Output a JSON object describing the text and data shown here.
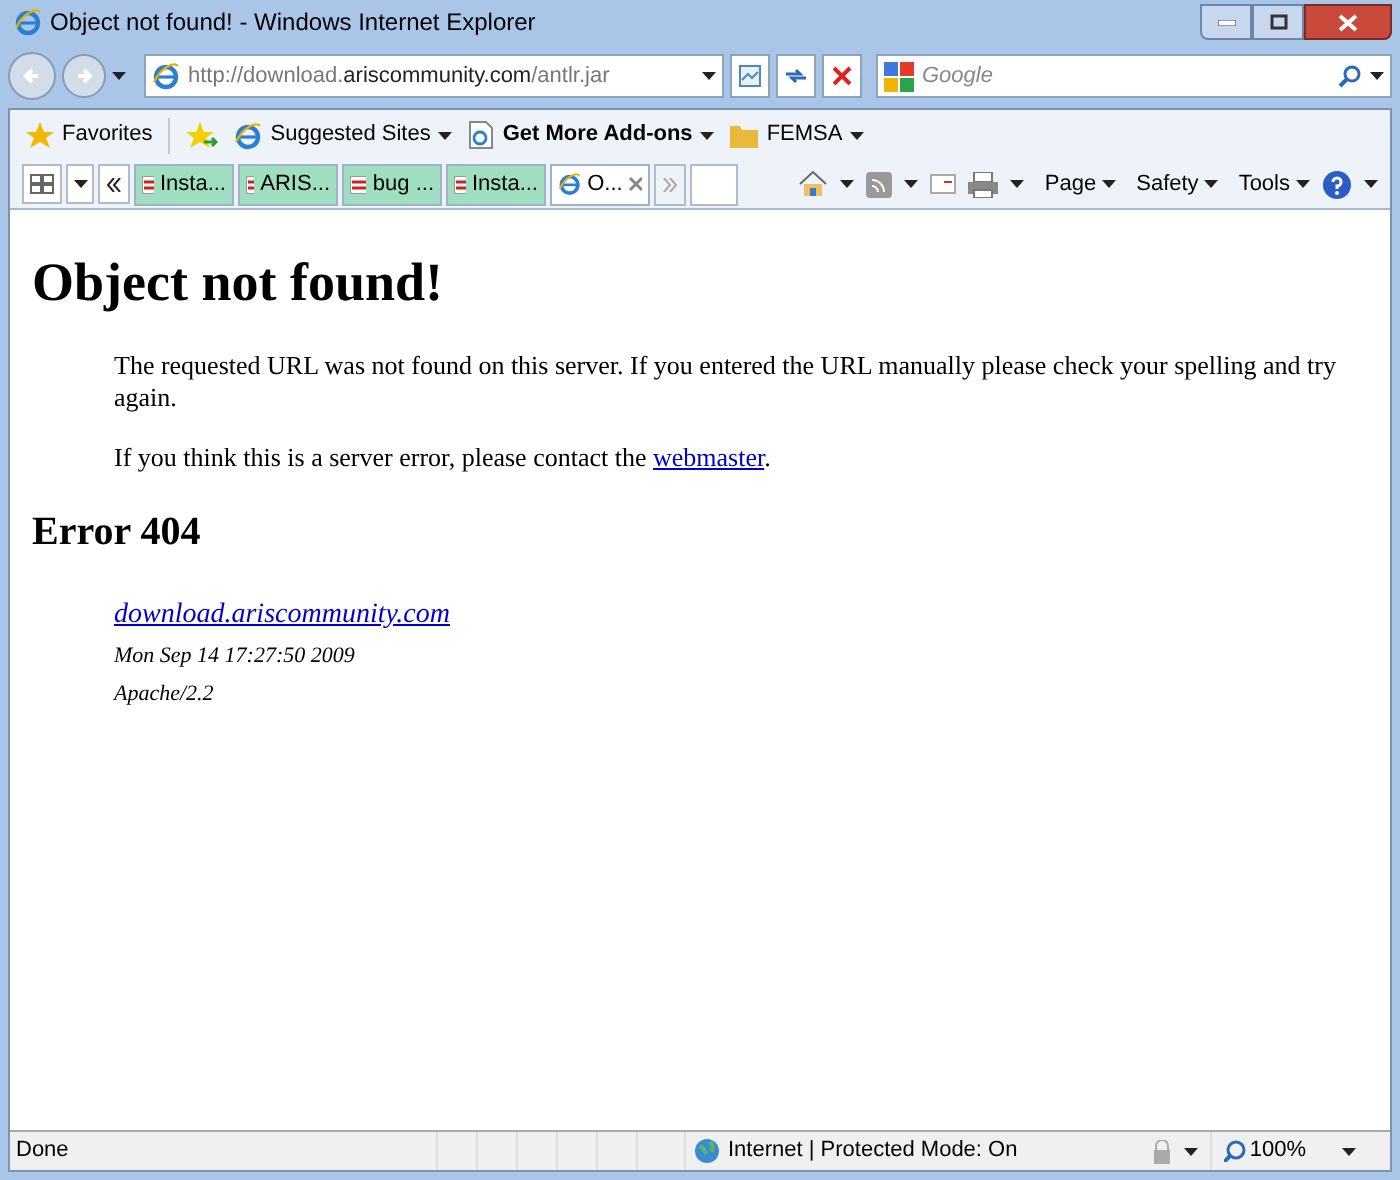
{
  "window": {
    "title": "Object not found! - Windows Internet Explorer"
  },
  "address": {
    "url": "http://download.**ariscommunity.com**/antlr.jar"
  },
  "search": {
    "placeholder": "Google"
  },
  "favorites_bar": {
    "favorites": "Favorites",
    "items": [
      {
        "label": "Suggested Sites",
        "bold": false,
        "kind": "ie"
      },
      {
        "label": "Get More Add-ons",
        "bold": true,
        "kind": "page"
      },
      {
        "label": "FEMSA",
        "bold": false,
        "kind": "folder"
      }
    ]
  },
  "tabs": [
    {
      "label": "Insta...",
      "selected": false
    },
    {
      "label": "ARIS...",
      "selected": false
    },
    {
      "label": "bug ...",
      "selected": false
    },
    {
      "label": "Insta...",
      "selected": false
    },
    {
      "label": "O...",
      "selected": true
    }
  ],
  "command_bar": [
    "Page",
    "Safety",
    "Tools"
  ],
  "page": {
    "heading": "Object not found!",
    "paragraphs": [
      "The requested URL was not found on this server. If you entered the URL manually please check your spelling and try again."
    ],
    "contact_text": "If you think this is a server error, please contact the",
    "contact_link": "webmaster",
    "contact_end": ".",
    "error_heading": "Error 404",
    "address_link": "download.ariscommunity.com",
    "date": "Mon Sep 14 17:27:50 2009",
    "server": "Apache/2.2"
  },
  "status_bar": {
    "status": "Done",
    "zone": "Internet | Protected Mode: On",
    "zoom": "100%"
  }
}
